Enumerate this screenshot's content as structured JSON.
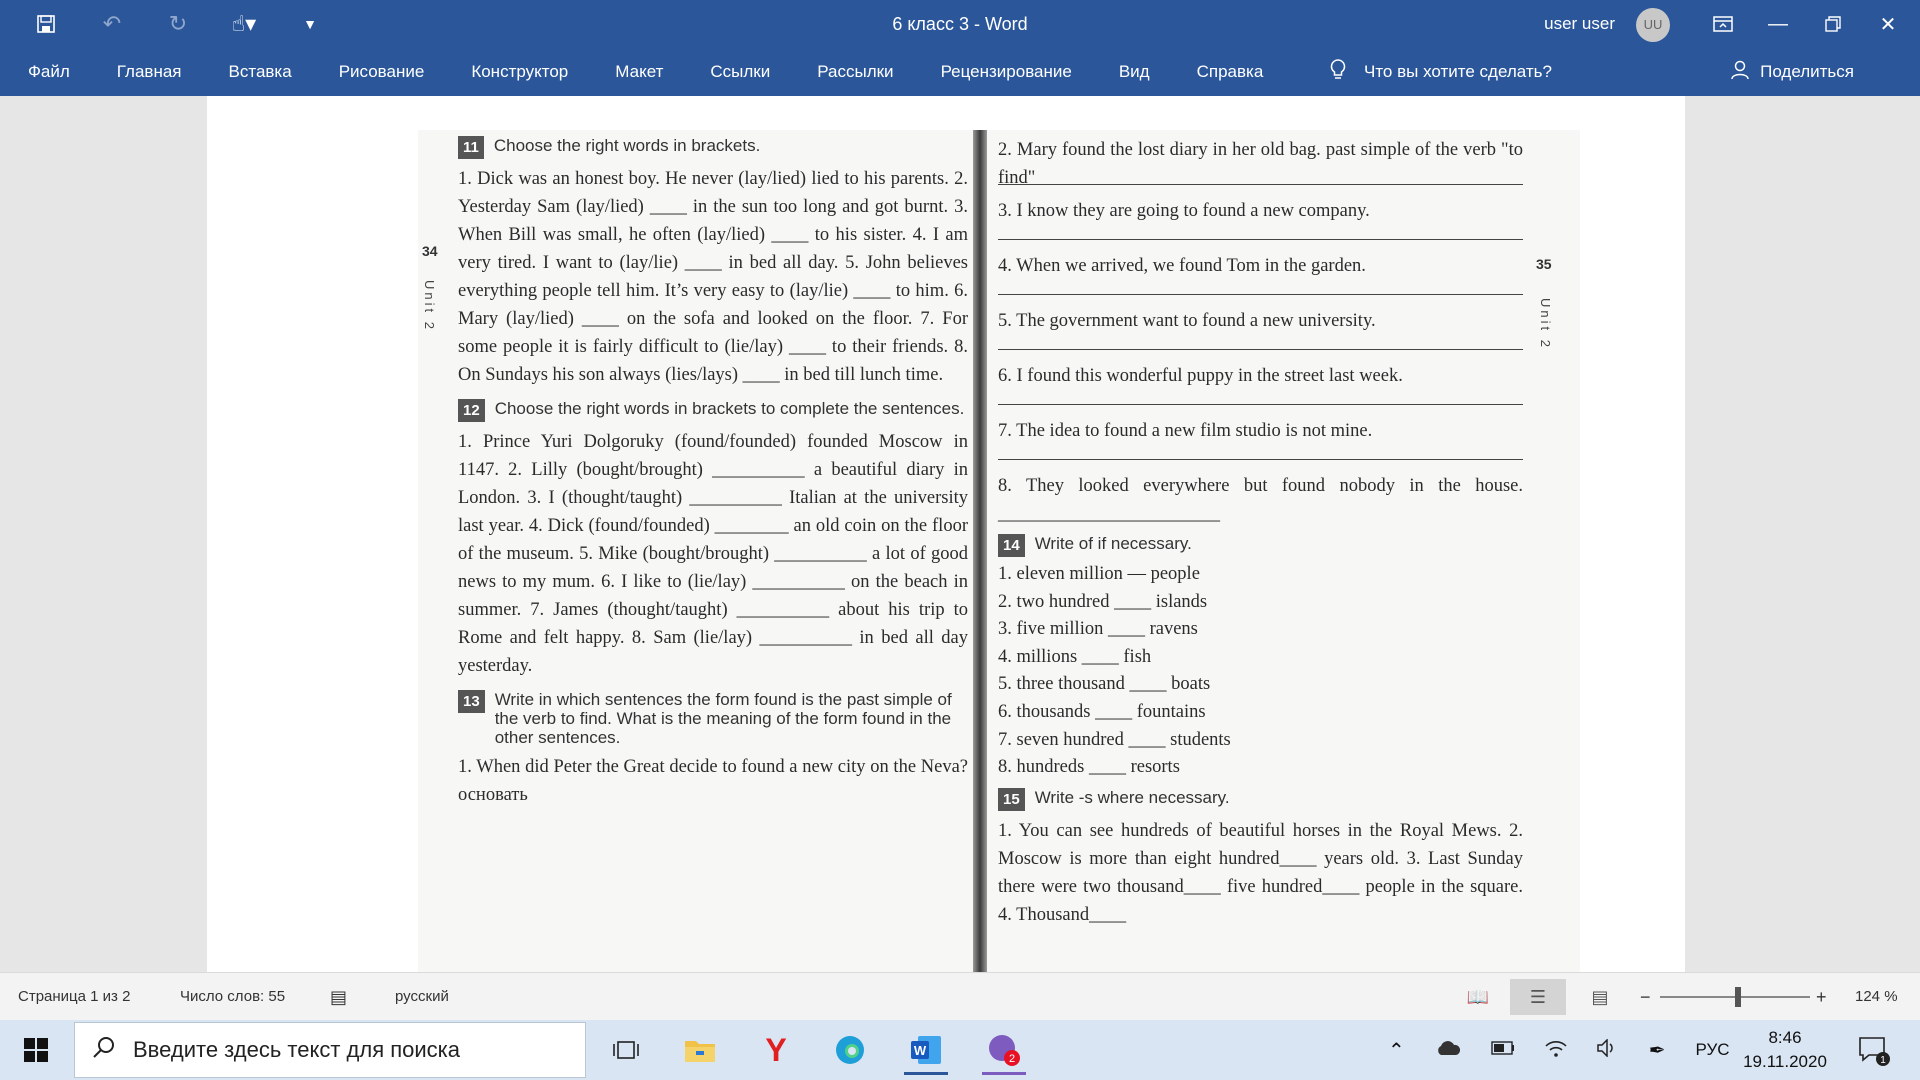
{
  "window": {
    "doc_title": "6 класс 3  -  Word",
    "user_name": "user user",
    "avatar_initials": "UU",
    "accent": "#2b579a"
  },
  "quick_access": [
    "save-icon",
    "undo-icon",
    "redo-icon",
    "touch-mode-icon",
    "customize-qat-icon"
  ],
  "ribbon": {
    "tabs": [
      "Файл",
      "Главная",
      "Вставка",
      "Рисование",
      "Конструктор",
      "Макет",
      "Ссылки",
      "Рассылки",
      "Рецензирование",
      "Вид",
      "Справка"
    ],
    "tell_me": "Что вы хотите сделать?",
    "share": "Поделиться"
  },
  "scan": {
    "page_left": "34",
    "page_right": "35",
    "unit_label": "Unit 2",
    "ex11": {
      "num": "11",
      "title": "Choose the right words in brackets.",
      "text": "1. Dick was an honest boy. He never (lay/lied) lied to his parents. 2. Yesterday Sam (lay/lied) ____ in the sun too long and got burnt. 3. When Bill was small, he often (lay/lied) ____ to his sister. 4. I am very tired. I want to (lay/lie) ____ in bed all day. 5. John believes everything people tell him. It’s very easy to (lay/lie) ____ to him. 6. Mary (lay/lied) ____ on the sofa and looked on the floor. 7. For some people it is fairly difficult to (lie/lay) ____ to their friends. 8. On Sundays his son always (lies/lays) ____ in bed till lunch time."
    },
    "ex12": {
      "num": "12",
      "title": "Choose the right words in brackets to complete the sentences.",
      "text": "1. Prince Yuri Dolgoruky (found/founded) founded Moscow in 1147. 2. Lilly (bought/brought) __________ a beautiful diary in London. 3. I (thought/taught) __________ Italian at the university last year. 4. Dick (found/founded) ________ an old coin on the floor of the museum. 5. Mike (bought/brought) __________ a lot of good news to my mum. 6. I like to (lie/lay) __________ on the beach in summer. 7. James (thought/taught) __________ about his trip to Rome and felt happy. 8. Sam (lie/lay) __________ in bed all day yesterday."
    },
    "ex13": {
      "num": "13",
      "title": "Write in which sentences the form found is the past simple of the verb to find. What is the meaning of the form found in the other sentences.",
      "text": "1. When did Peter the Great decide to found a new city on the Neva? основать"
    },
    "ex13_cont": [
      "2. Mary found the lost diary in her old bag. past simple of the verb \"to find\"",
      "3. I know they are going to found a new company.",
      "4. When we arrived, we found Tom in the garden.",
      "5. The government want to found a new university.",
      "6. I found this wonderful puppy in the street last week.",
      "7. The idea to found a new film studio is not mine.",
      "8. They looked everywhere but found nobody in the house. ________________________"
    ],
    "ex14": {
      "num": "14",
      "title": "Write of if necessary.",
      "items": [
        "1. eleven million — people",
        "2. two hundred ____ islands",
        "3. five million ____ ravens",
        "4. millions ____ fish",
        "5. three thousand ____ boats",
        "6. thousands ____ fountains",
        "7. seven hundred ____ students",
        "8. hundreds ____ resorts"
      ]
    },
    "ex15": {
      "num": "15",
      "title": "Write -s where necessary.",
      "text": "1. You can see hundreds of beautiful horses in the Royal Mews. 2. Moscow is more than eight hundred____ years old. 3. Last Sunday there were two thousand____ five hundred____ people in the square. 4. Thousand____"
    }
  },
  "statusbar": {
    "page": "Страница 1 из 2",
    "words": "Число слов: 55",
    "language": "русский",
    "zoom": "124 %",
    "zoom_value": 124
  },
  "taskbar": {
    "search_placeholder": "Введите здесь текст для поиска",
    "lang": "РУС",
    "time": "8:46",
    "date": "19.11.2020",
    "viber_badge": "2",
    "notif_badge": "1"
  }
}
